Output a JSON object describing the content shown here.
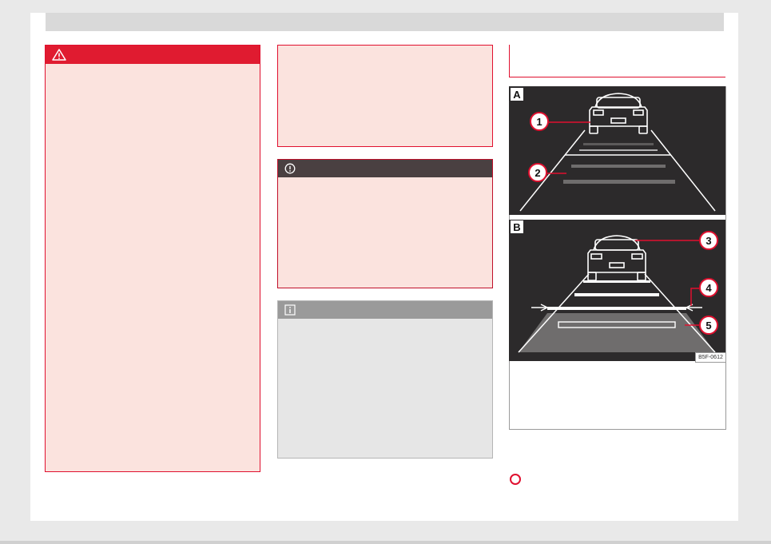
{
  "figure": {
    "panels": [
      {
        "letter": "A",
        "callouts": [
          "1",
          "2"
        ]
      },
      {
        "letter": "B",
        "callouts": [
          "3",
          "4",
          "5"
        ]
      }
    ],
    "code": "B5F-0612"
  },
  "icons": {
    "warning": "warning-triangle-icon",
    "caution": "caution-circle-icon",
    "info": "info-icon",
    "reference": "reference-circle-icon"
  },
  "colors": {
    "warning_red": "#e01b30",
    "warning_bg": "#fbe3de",
    "caution_head": "#4a4041",
    "info_head": "#9a9a9a",
    "info_bg": "#e6e6e6",
    "figure_bg": "#2c2a2b"
  }
}
